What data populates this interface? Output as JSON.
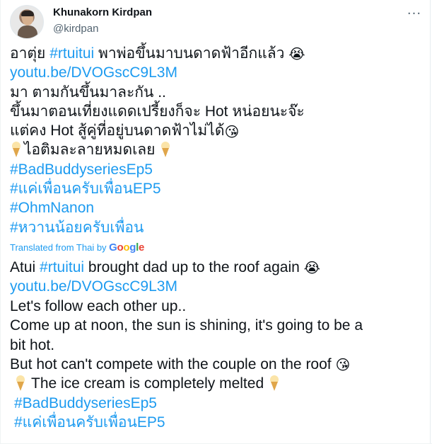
{
  "tweet": {
    "author_name": "Khunakorn Kirdpan",
    "author_handle": "@kirdpan",
    "more_label": "···",
    "original": {
      "line1_text": "อาตุ่ย ",
      "line1_tag": "#rtuitui",
      "line1_rest": " พาพ่อขึ้นมาบนดาดฟ้าอีกแล้ว ",
      "line1_emoji": "😭",
      "link": "youtu.be/DVOGscC9L3M",
      "line3": "มา ตามกันขึ้นมาละกัน ..",
      "line4": "ขึ้นมาตอนเที่ยงแดดเปรี้ยงก็จะ Hot หน่อยนะจ๊ะ",
      "line5_text": "แต่คง Hot สู้คู่ที่อยู่บนดาดฟ้าไม่ได้",
      "line5_emoji": "😘",
      "line6_text": "ไอติมละลายหมดเลย",
      "tag1": "#BadBuddyseriesEp5",
      "tag2": "#แค่เพื่อนครับเพื่อนEP5",
      "tag3": "#OhmNanon",
      "tag4": "#หวานน้อยครับเพื่อน"
    },
    "translated_label": "Translated from Thai by ",
    "google": {
      "g1": "G",
      "o1": "o",
      "o2": "o",
      "g2": "g",
      "l": "l",
      "e": "e"
    },
    "translation": {
      "line1_text": "Atui ",
      "line1_tag": "#rtuitui",
      "line1_rest": " brought dad up to the roof again ",
      "line1_emoji": "😭",
      "link": "youtu.be/DVOGscC9L3M",
      "line3": " Let's follow each other up..",
      "line4": " Come up at noon, the sun is shining, it's going to be a",
      "line4b": "bit hot.",
      "line5_text": " But hot can't compete with the couple on the roof ",
      "line5_emoji": "😘",
      "line6_text": "The ice cream is completely melted",
      "tag1": "#BadBuddyseriesEp5",
      "tag2": "#แค่เพื่อนครับเพื่อนEP5"
    }
  },
  "colors": {
    "link": "#1d9bf0",
    "text": "#0f1419",
    "secondary": "#536471"
  }
}
